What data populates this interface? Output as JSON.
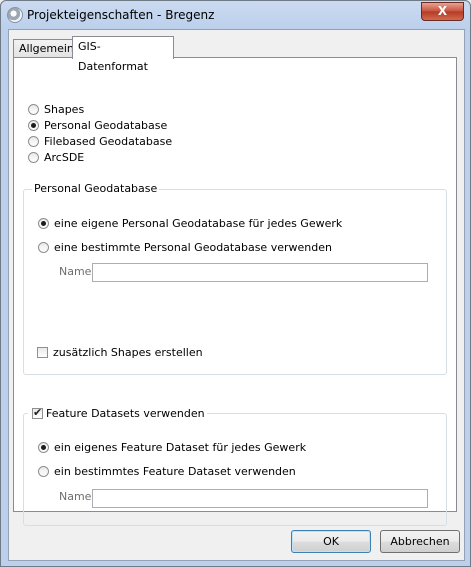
{
  "window": {
    "title": "Projekteigenschaften - Bregenz",
    "close_glyph": "X"
  },
  "tabs": [
    {
      "label": "Allgemein",
      "active": false
    },
    {
      "label": "GIS-Datenformat",
      "active": true
    }
  ],
  "format_options": [
    {
      "label": "Shapes",
      "selected": false
    },
    {
      "label": "Personal Geodatabase",
      "selected": true
    },
    {
      "label": "Filebased Geodatabase",
      "selected": false
    },
    {
      "label": "ArcSDE",
      "selected": false
    }
  ],
  "personal_geodatabase_group": {
    "legend": "Personal Geodatabase",
    "options": [
      {
        "label": "eine eigene Personal Geodatabase für jedes Gewerk",
        "selected": true
      },
      {
        "label": "eine bestimmte Personal Geodatabase verwenden",
        "selected": false
      }
    ],
    "name_label": "Name",
    "name_value": "",
    "extra_shapes_label": "zusätzlich Shapes erstellen",
    "extra_shapes_checked": false
  },
  "feature_dataset_group": {
    "legend": "Feature Datasets verwenden",
    "enabled": true,
    "options": [
      {
        "label": "ein eigenes Feature Dataset für jedes Gewerk",
        "selected": true
      },
      {
        "label": "ein bestimmtes Feature Dataset verwenden",
        "selected": false
      }
    ],
    "name_label": "Name",
    "name_value": ""
  },
  "buttons": {
    "ok": "OK",
    "cancel": "Abbrechen"
  },
  "colors": {
    "titlebar": "#bcd0ec",
    "close_button": "#c7503b",
    "panel": "#ffffff",
    "dialog": "#f0f0f0"
  }
}
